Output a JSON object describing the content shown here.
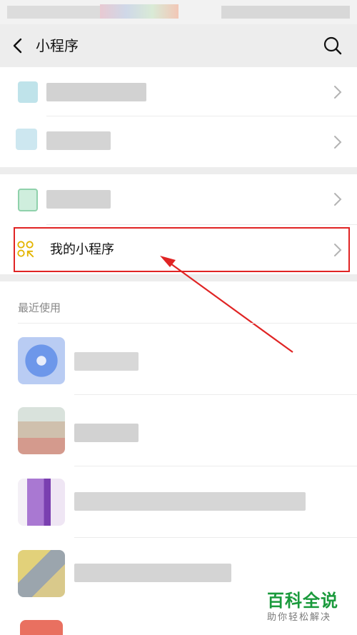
{
  "nav": {
    "title": "小程序"
  },
  "rows": {
    "my_mini_programs": "我的小程序"
  },
  "recent": {
    "section_label": "最近使用"
  },
  "watermark": {
    "title": "百科全说",
    "subtitle": "助你轻松解决"
  },
  "colors": {
    "accent_red": "#e02424",
    "nav_bg": "#ededed",
    "watermark_green": "#1a9a3c"
  }
}
